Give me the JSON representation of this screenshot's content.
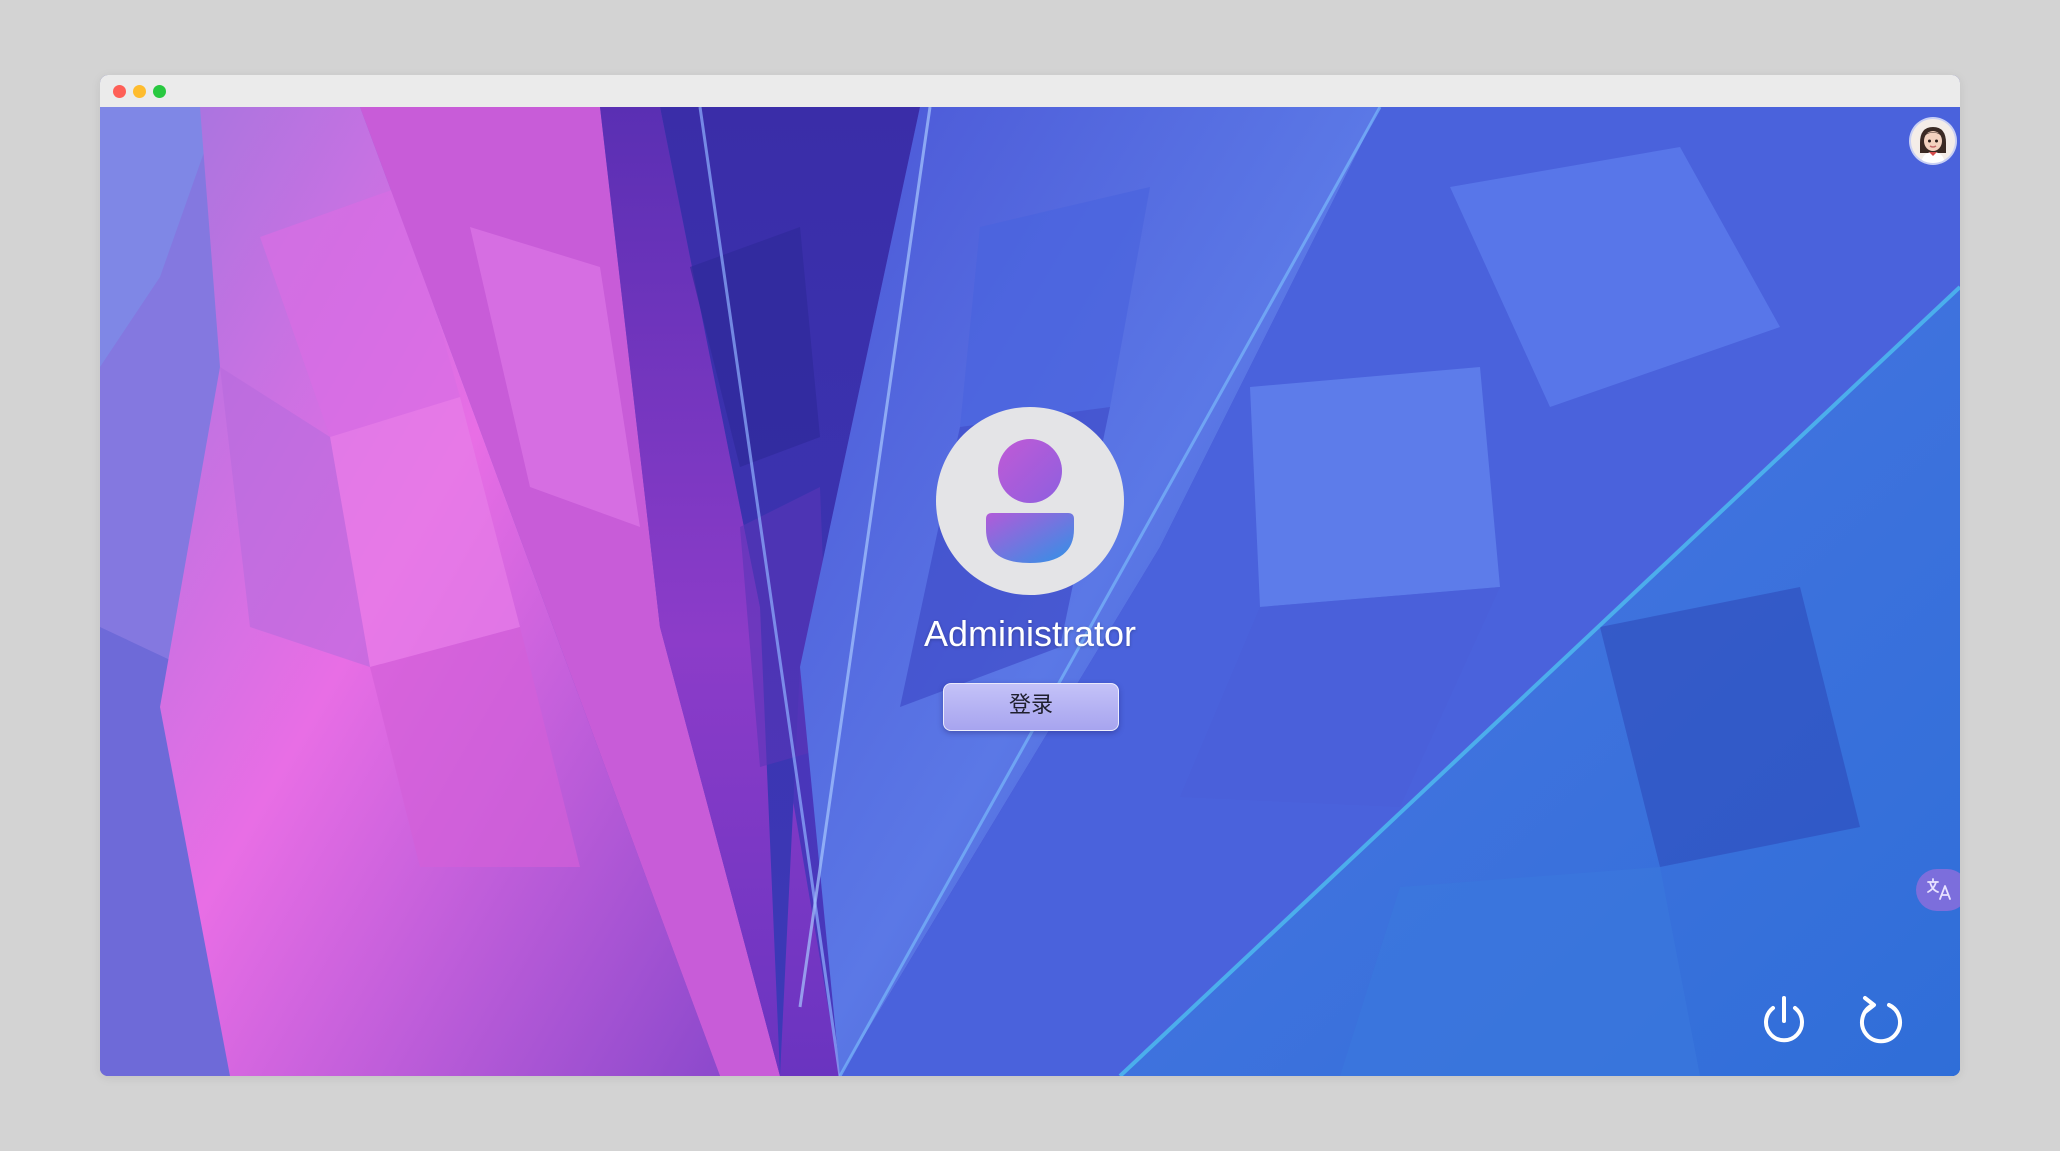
{
  "window": {
    "controls": [
      "close",
      "minimize",
      "maximize"
    ]
  },
  "login": {
    "username": "Administrator",
    "login_button_label": "登录"
  },
  "icons": {
    "top_avatar": "user-avatar-icon",
    "user_avatar": "default-user-icon",
    "language": "translate-icon",
    "power": "power-icon",
    "restart": "restart-icon"
  },
  "colors": {
    "page_background": "#d3d3d3",
    "titlebar": "#ebebeb",
    "close": "#fe5f57",
    "minimize": "#febc2e",
    "maximize": "#28c840",
    "login_button": "#b5b2f5",
    "username_text": "#ffffff",
    "avatar_gradient_top": "#b25ad9",
    "avatar_gradient_bottom": "#2f92e6"
  }
}
